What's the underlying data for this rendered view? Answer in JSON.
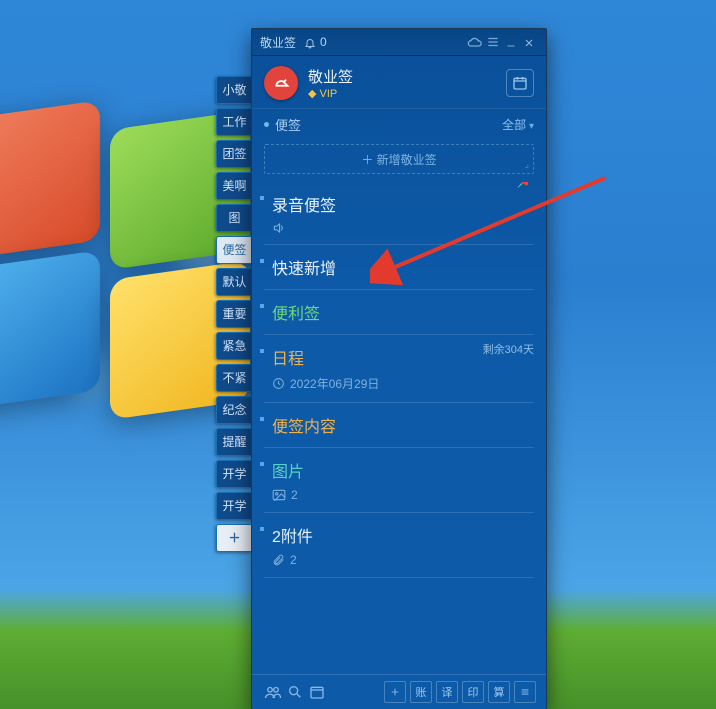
{
  "titlebar": {
    "app_name": "敬业签",
    "bell_count": "0"
  },
  "header": {
    "brand": "敬业签",
    "vip_label": "VIP"
  },
  "section": {
    "label": "便签",
    "all_label": "全部"
  },
  "addbox": {
    "placeholder": "＋ 新增敬业签"
  },
  "side_tabs": [
    "小敬",
    "工作",
    "团签",
    "美啊",
    "图",
    "便签",
    "默认",
    "重要",
    "紧急",
    "不紧",
    "纪念",
    "提醒",
    "开学",
    "开学"
  ],
  "side_active_index": 5,
  "side_add": "＋",
  "items": [
    {
      "title": "录音便签",
      "meta_icon": "sound",
      "meta": "",
      "pin": true
    },
    {
      "title": "快速新增"
    },
    {
      "title": "便利签",
      "color": "green"
    },
    {
      "title": "日程",
      "color": "orange",
      "badge": "剩余304天",
      "meta_icon": "clock",
      "meta": "2022年06月29日"
    },
    {
      "title": "便签内容",
      "color": "orange"
    },
    {
      "title": "图片",
      "color": "teal",
      "meta_icon": "image",
      "meta": "2"
    },
    {
      "title": "2附件",
      "meta_icon": "attach",
      "meta": "2"
    }
  ],
  "footer": {
    "buttons": [
      "账",
      "译",
      "印",
      "算"
    ]
  }
}
